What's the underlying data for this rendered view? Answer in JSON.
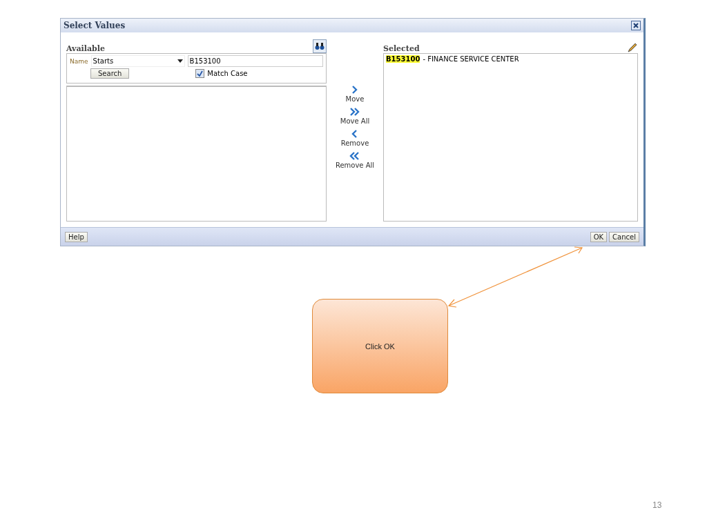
{
  "dialog": {
    "title": "Select Values",
    "available": {
      "heading": "Available",
      "name_label": "Name",
      "operator": "Starts",
      "search_value": "B153100",
      "search_button": "Search",
      "match_case": {
        "label": "Match Case",
        "checked": true
      }
    },
    "shuttle": [
      {
        "kind": "move",
        "label": "Move"
      },
      {
        "kind": "move_all",
        "label": "Move All"
      },
      {
        "kind": "remove",
        "label": "Remove"
      },
      {
        "kind": "remove_all",
        "label": "Remove All"
      }
    ],
    "selected": {
      "heading": "Selected",
      "items": [
        {
          "code": "B153100",
          "description": "- FINANCE SERVICE CENTER",
          "highlighted": true
        }
      ]
    },
    "footer": {
      "help": "Help",
      "ok": "OK",
      "cancel": "Cancel"
    }
  },
  "callout": {
    "text": "Click OK"
  },
  "page_number": "13"
}
